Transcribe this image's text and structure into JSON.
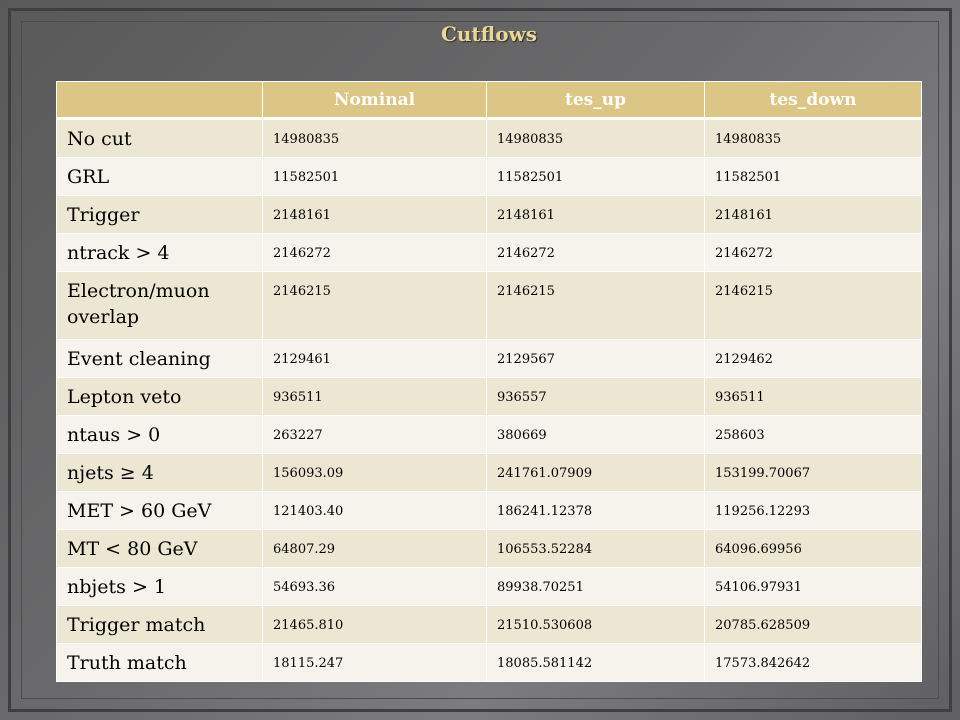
{
  "title": "Cutflows",
  "columns": [
    "",
    "Nominal",
    "tes_up",
    "tes_down"
  ],
  "rows": [
    {
      "label": "No cut",
      "values": [
        "14980835",
        "14980835",
        "14980835"
      ]
    },
    {
      "label": "GRL",
      "values": [
        "11582501",
        "11582501",
        "11582501"
      ]
    },
    {
      "label": "Trigger",
      "values": [
        "2148161",
        "2148161",
        "2148161"
      ]
    },
    {
      "label": "ntrack > 4",
      "values": [
        "2146272",
        "2146272",
        "2146272"
      ]
    },
    {
      "label": "Electron/muon overlap",
      "values": [
        "2146215",
        "2146215",
        "2146215"
      ]
    },
    {
      "label": "Event cleaning",
      "values": [
        "2129461",
        "2129567",
        "2129462"
      ]
    },
    {
      "label": "Lepton veto",
      "values": [
        "936511",
        "936557",
        "936511"
      ]
    },
    {
      "label": "ntaus > 0",
      "values": [
        "263227",
        "380669",
        "258603"
      ]
    },
    {
      "label": "njets ≥ 4",
      "values": [
        "156093.09",
        "241761.07909",
        "153199.70067"
      ]
    },
    {
      "label": "MET > 60 GeV",
      "values": [
        "121403.40",
        "186241.12378",
        "119256.12293"
      ]
    },
    {
      "label": "MT < 80 GeV",
      "values": [
        "64807.29",
        "106553.52284",
        "64096.69956"
      ]
    },
    {
      "label": "nbjets > 1",
      "values": [
        "54693.36",
        "89938.70251",
        "54106.97931"
      ]
    },
    {
      "label": "Trigger match",
      "values": [
        "21465.810",
        "21510.530608",
        "20785.628509"
      ]
    },
    {
      "label": "Truth match",
      "values": [
        "18115.247",
        "18085.581142",
        "17573.842642"
      ]
    }
  ],
  "colors": {
    "header_bg": "#dcc685",
    "row_odd": "#ede6d3",
    "row_even": "#f6f3ec",
    "title": "#e9d79a"
  }
}
